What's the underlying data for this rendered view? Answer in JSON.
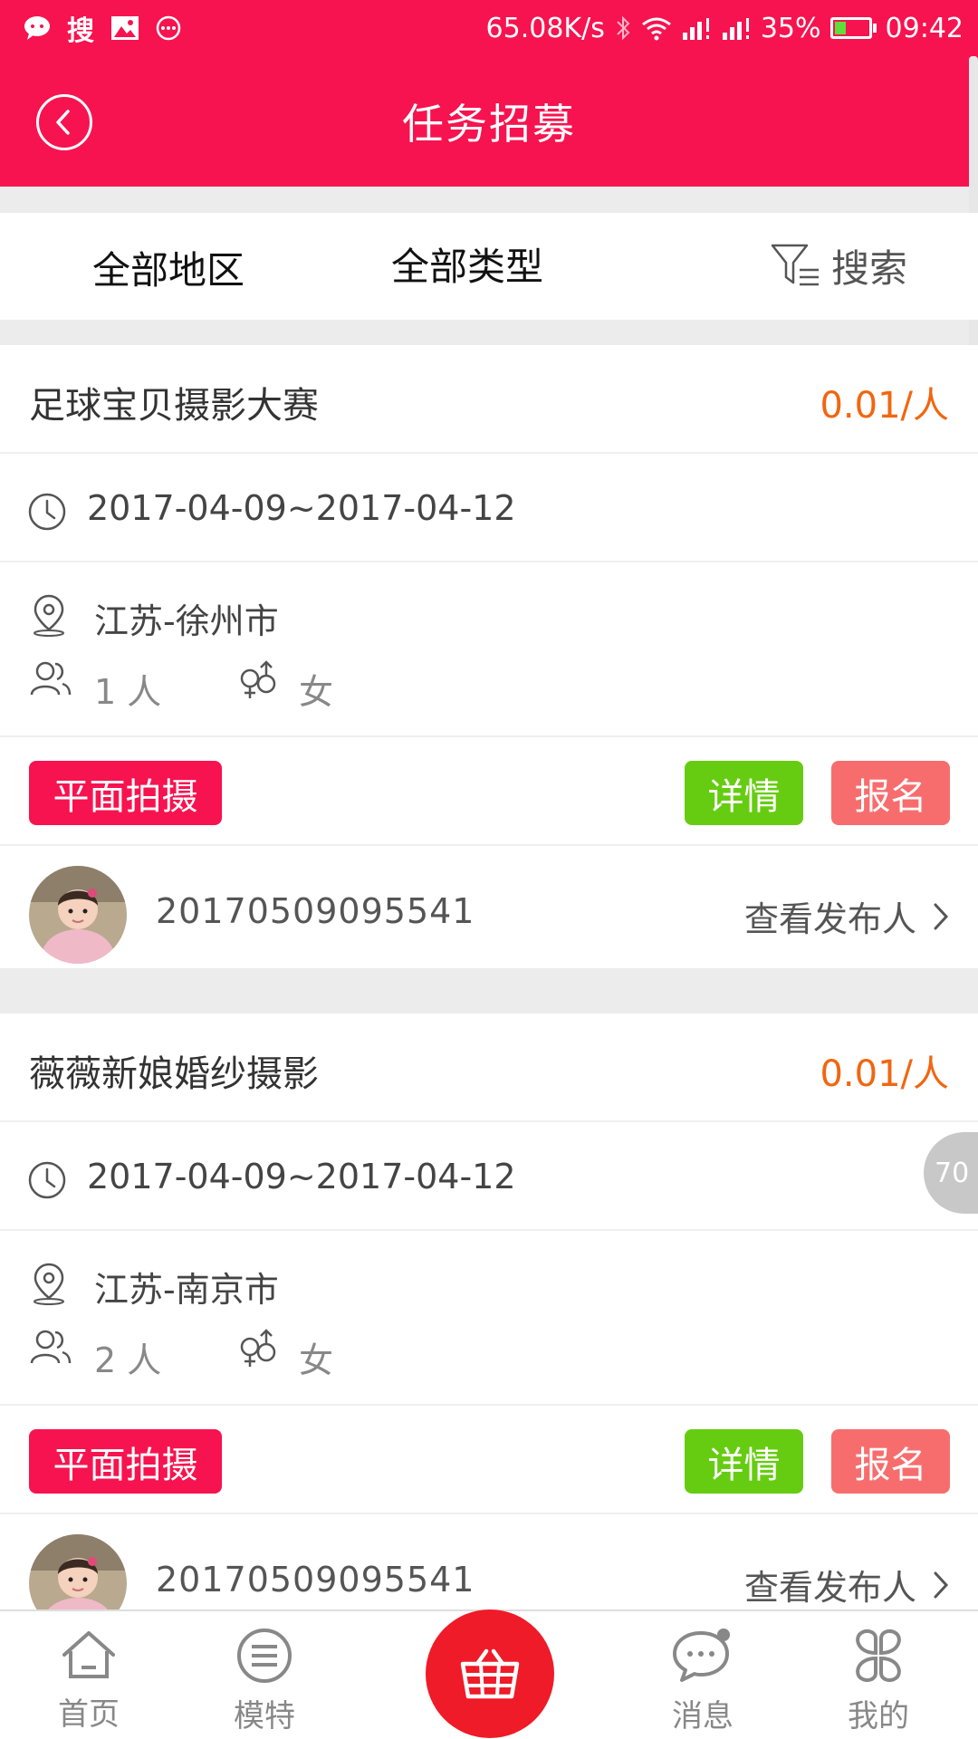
{
  "status_bar": {
    "left_icons": [
      "message-bubble-icon",
      "sogou-icon",
      "image-icon",
      "more-circle-icon"
    ],
    "sogou_label": "搜",
    "net_speed": "65.08K/s",
    "battery": "35%",
    "time": "09:42"
  },
  "header": {
    "title": "任务招募"
  },
  "filter": {
    "region": "全部地区",
    "type": "全部类型",
    "search": "搜索"
  },
  "jobs": [
    {
      "title": "足球宝贝摄影大赛",
      "price": "0.01/人",
      "date_range": "2017-04-09~2017-04-12",
      "location": "江苏-徐州市",
      "people": "1 人",
      "gender": "女",
      "tag": "平面拍摄",
      "detail_label": "详情",
      "signup_label": "报名",
      "publisher_id": "20170509095541",
      "publisher_link": "查看发布人"
    },
    {
      "title": "薇薇新娘婚纱摄影",
      "price": "0.01/人",
      "date_range": "2017-04-09~2017-04-12",
      "location": "江苏-南京市",
      "people": "2 人",
      "gender": "女",
      "tag": "平面拍摄",
      "detail_label": "详情",
      "signup_label": "报名",
      "publisher_id": "20170509095541",
      "publisher_link": "查看发布人"
    }
  ],
  "float_badge": "70",
  "bottom_nav": {
    "home": "首页",
    "models": "模特",
    "messages": "消息",
    "mine": "我的"
  },
  "colors": {
    "brand": "#f7134f",
    "price": "#f2660f",
    "detail": "#66cc11",
    "signup": "#f76d6d",
    "cart": "#ef1b28"
  }
}
